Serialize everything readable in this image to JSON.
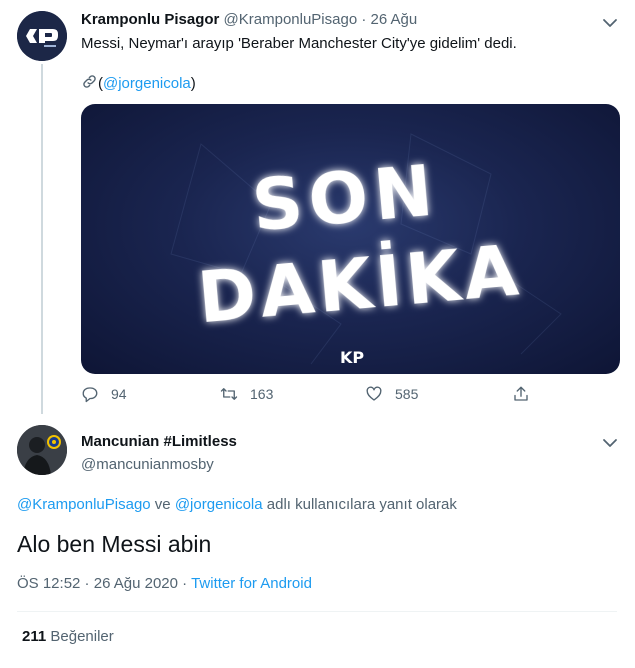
{
  "tweet1": {
    "author_name": "Kramponlu Pisagor",
    "author_handle": "@KramponluPisago",
    "separator": "·",
    "date": "26 Ağu",
    "text": "Messi, Neymar'ı arayıp 'Beraber Manchester City'ye gidelim' dedi.",
    "link_open": "(",
    "link_text": "@jorgenicola",
    "link_close": ")",
    "media": {
      "line1": "SON",
      "line2": "DAKİKA",
      "logo": "KP"
    },
    "actions": {
      "replies": "94",
      "retweets": "163",
      "likes": "585"
    }
  },
  "tweet2": {
    "author_name": "Mancunian #Limitless",
    "author_handle": "@mancunianmosby",
    "reply_user1": "@KramponluPisago",
    "reply_and": " ve ",
    "reply_user2": "@jorgenicola",
    "reply_suffix": " adlı kullanıcılara yanıt olarak",
    "text": "Alo ben Messi abin",
    "time": "ÖS 12:52",
    "separator": " · ",
    "date": "26 Ağu 2020",
    "source": "Twitter for Android",
    "likes_count": "211",
    "likes_label": "Beğeniler"
  },
  "icons": {
    "reply": "reply-icon",
    "retweet": "retweet-icon",
    "like": "heart-icon",
    "share": "share-icon",
    "link": "link-icon",
    "caret": "chevron-down-icon"
  },
  "colors": {
    "accent": "#1d9bf0",
    "muted": "#536471",
    "text": "#0f1419"
  }
}
